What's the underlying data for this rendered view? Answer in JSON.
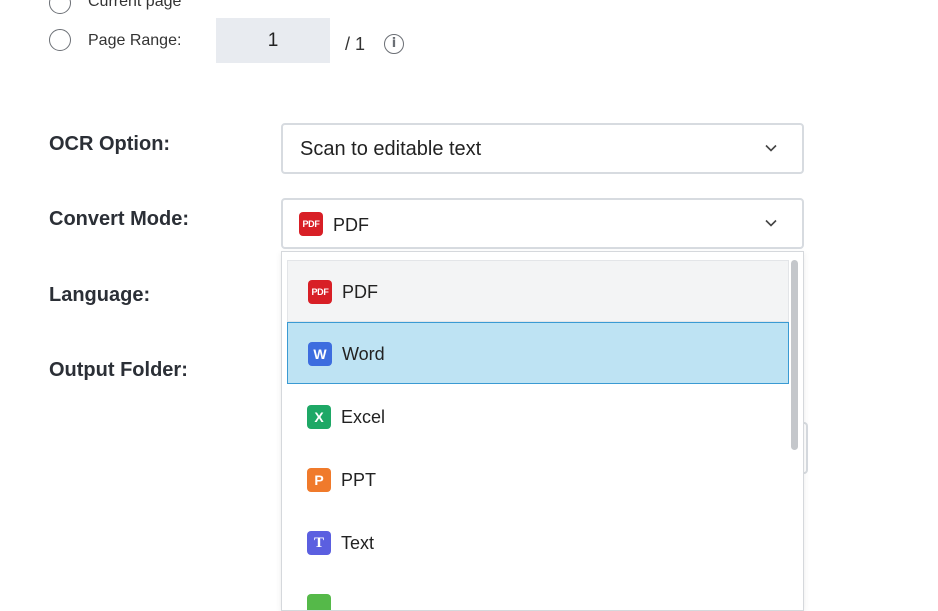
{
  "page_range": {
    "current_page_label": "Current page",
    "page_range_label": "Page Range:",
    "page_input_value": "1",
    "total_pages": "/ 1",
    "info_icon": "info-icon"
  },
  "fields": {
    "ocr_option_label": "OCR Option:",
    "ocr_option_value": "Scan to editable text",
    "convert_mode_label": "Convert Mode:",
    "convert_mode_value": "PDF",
    "language_label": "Language:",
    "output_folder_label": "Output Folder:"
  },
  "convert_mode_dropdown": {
    "hovered": "PDF",
    "selected": "Word",
    "options": [
      {
        "label": "PDF",
        "icon": "pdf-icon",
        "icon_text": "PDF",
        "color": "#d81f26"
      },
      {
        "label": "Word",
        "icon": "word-icon",
        "icon_text": "W",
        "color": "#3d6ddf"
      },
      {
        "label": "Excel",
        "icon": "excel-icon",
        "icon_text": "X",
        "color": "#1ea866"
      },
      {
        "label": "PPT",
        "icon": "ppt-icon",
        "icon_text": "P",
        "color": "#f07a2b"
      },
      {
        "label": "Text",
        "icon": "text-icon",
        "icon_text": "T",
        "color": "#5b5fe0"
      },
      {
        "label": "",
        "icon": "image-icon",
        "icon_text": "",
        "color": "#55b949"
      }
    ]
  },
  "colors": {
    "selected_bg": "#bee3f3",
    "selected_border": "#3a9ad3",
    "input_bg": "#e8ebf0"
  }
}
